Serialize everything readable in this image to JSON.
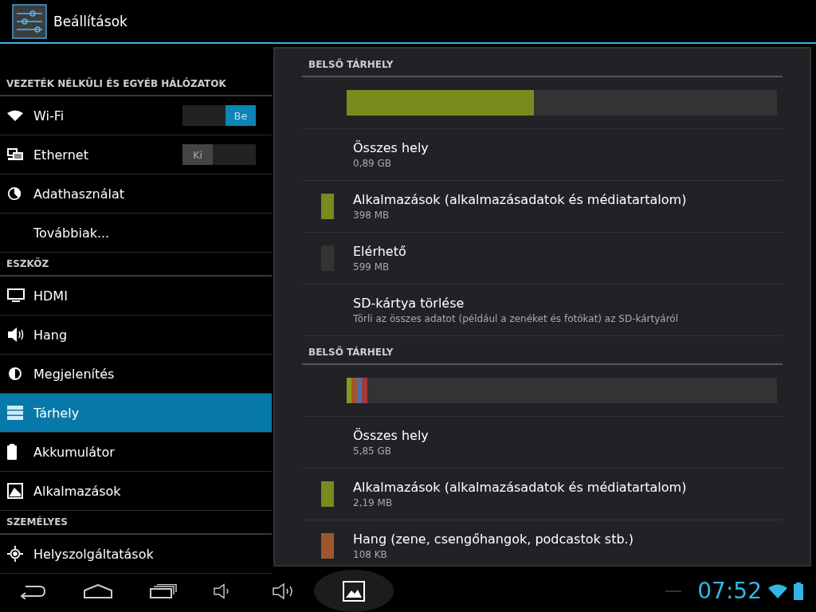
{
  "action_bar": {
    "title": "Beállítások"
  },
  "sidebar": {
    "items": [
      {
        "kind": "header",
        "label": "VEZETÉK NÉLKÜLI ÉS EGYÉB HÁLÓZATOK"
      },
      {
        "kind": "item",
        "label": "Wi-Fi",
        "selected": false,
        "toggle": {
          "label": "Be",
          "on": true
        }
      },
      {
        "kind": "item",
        "label": "Ethernet",
        "selected": false,
        "toggle": {
          "label": "Ki",
          "on": false
        }
      },
      {
        "kind": "item",
        "label": "Adathasználat",
        "selected": false
      },
      {
        "kind": "item",
        "label": "Továbbiak...",
        "selected": false
      },
      {
        "kind": "header",
        "label": "ESZKÖZ"
      },
      {
        "kind": "item",
        "label": "HDMI",
        "selected": false
      },
      {
        "kind": "item",
        "label": "Hang",
        "selected": false
      },
      {
        "kind": "item",
        "label": "Megjelenítés",
        "selected": false
      },
      {
        "kind": "item",
        "label": "Tárhely",
        "selected": true
      },
      {
        "kind": "item",
        "label": "Akkumulátor",
        "selected": false
      },
      {
        "kind": "item",
        "label": "Alkalmazások",
        "selected": false
      },
      {
        "kind": "header",
        "label": "SZEMÉLYES"
      },
      {
        "kind": "item",
        "label": "Helyszolgáltatások",
        "selected": false
      }
    ]
  },
  "storage_sections": [
    {
      "title": "BELSŐ TÁRHELY",
      "bar": [
        {
          "color": "#7a8a1c",
          "level": 0.435
        }
      ],
      "rows": [
        {
          "label": "Összes hely",
          "value": "0,89 GB"
        },
        {
          "label": "Alkalmazások (alkalmazásadatok és médiatartalom)",
          "value": "398 MB",
          "color": "#7a8a1c"
        },
        {
          "label": "Elérhető",
          "value": "599 MB",
          "color": "#333333"
        },
        {
          "label": "SD-kártya törlése",
          "value": "Törli az összes adatot (például a zenéket és fotókat) az SD-kártyáról"
        }
      ]
    },
    {
      "title": "BELSŐ TÁRHELY",
      "bar": [
        {
          "color": "#8a9a1c",
          "level": 0.012
        },
        {
          "color": "#a0562c",
          "level": 0.012
        },
        {
          "color": "#4d6fa8",
          "level": 0.012
        },
        {
          "color": "#a03a3a",
          "level": 0.012
        }
      ],
      "rows": [
        {
          "label": "Összes hely",
          "value": "5,85 GB"
        },
        {
          "label": "Alkalmazások (alkalmazásadatok és médiatartalom)",
          "value": "2,19 MB",
          "color": "#7a8a1c"
        },
        {
          "label": "Hang (zene, csengőhangok, podcastok stb.)",
          "value": "108 KB",
          "color": "#a0562c"
        }
      ]
    }
  ],
  "status": {
    "time": "07:52"
  }
}
